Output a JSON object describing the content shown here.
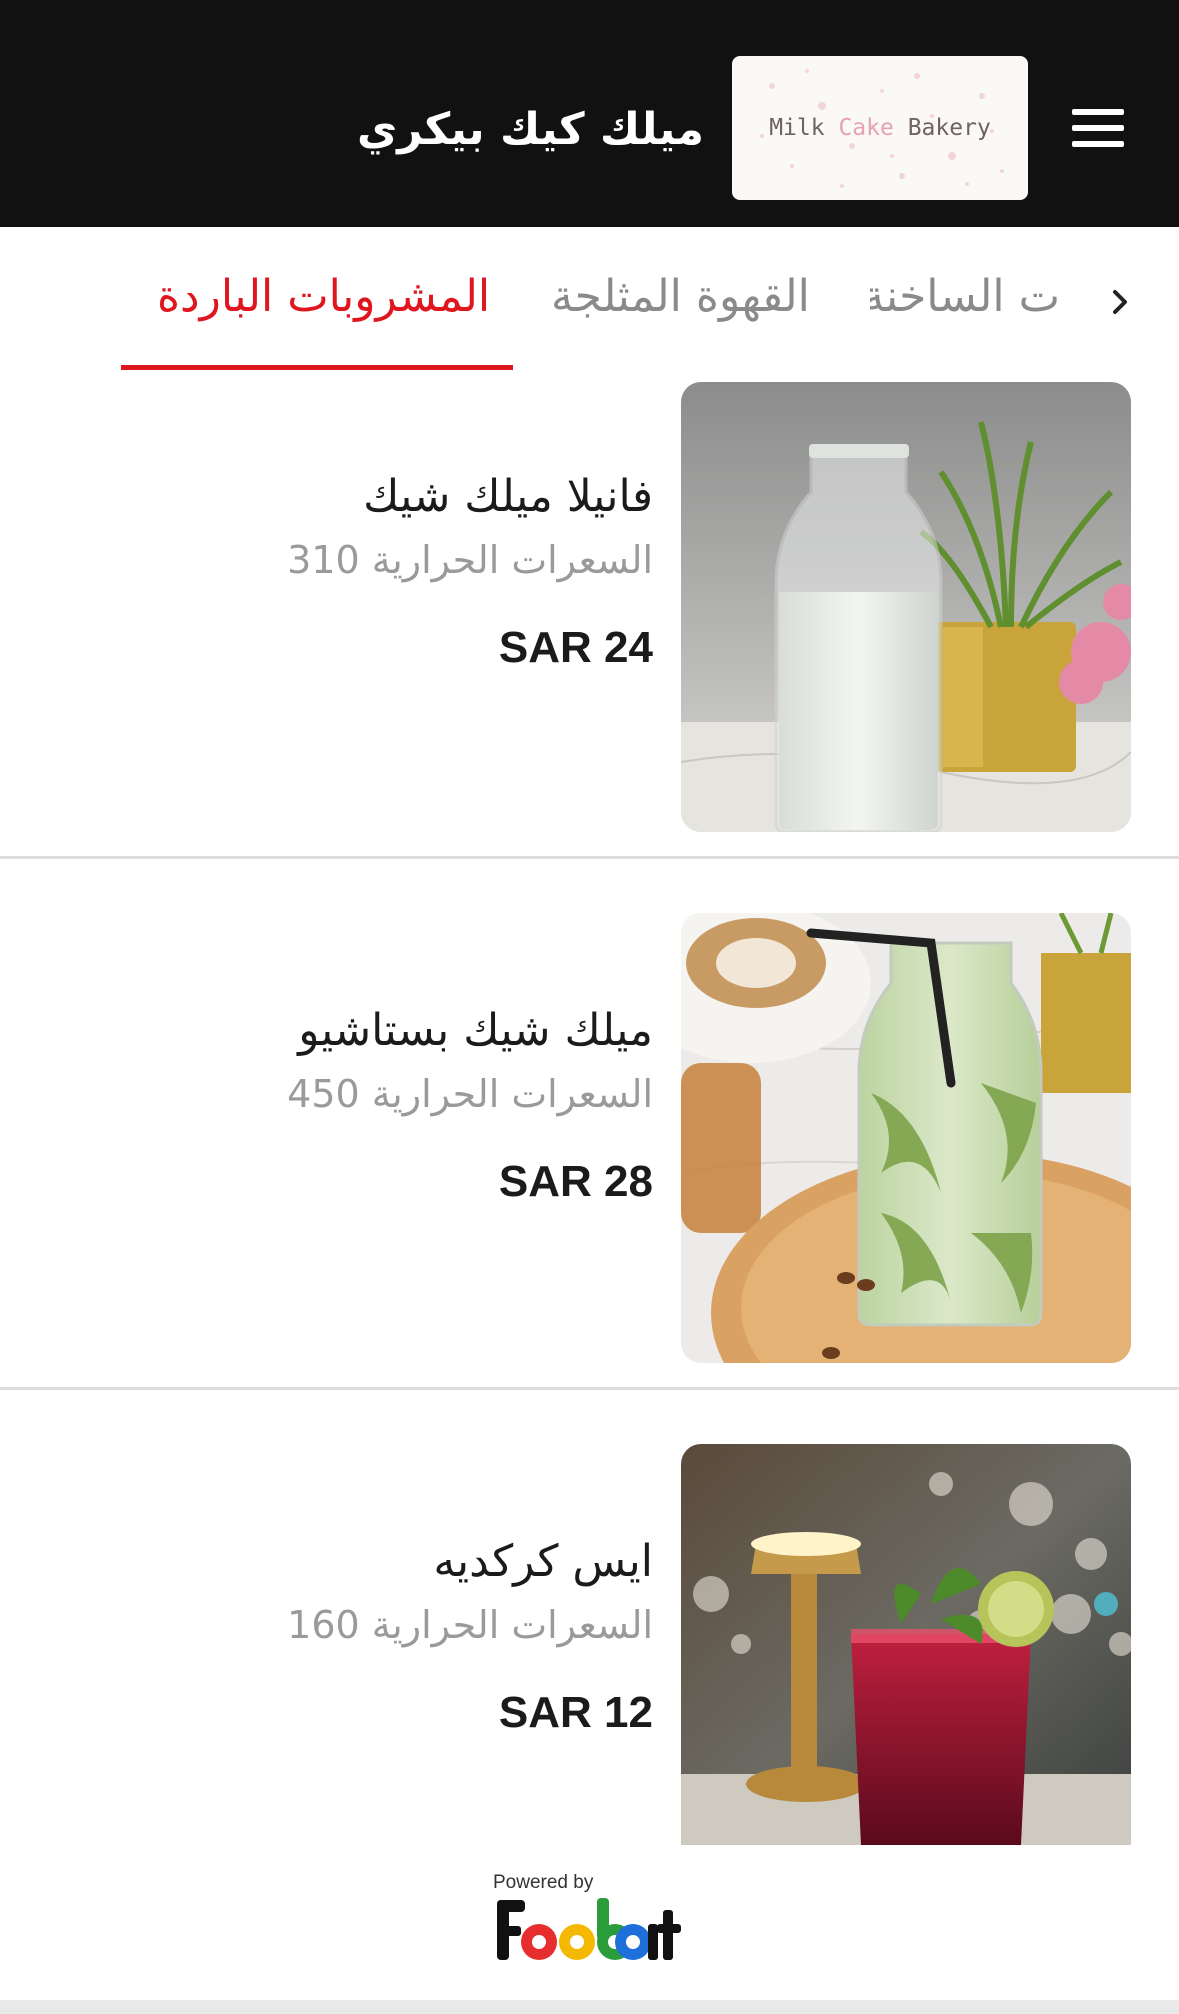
{
  "header": {
    "store_name": "ميلك كيك بيكري",
    "logo_text_1": "Milk",
    "logo_text_2": "Cake",
    "logo_text_3": "Bakery",
    "menu_icon": "hamburger-menu-icon"
  },
  "tabs": [
    {
      "label": "المشروبات الباردة",
      "active": true
    },
    {
      "label": "القهوة المثلجة",
      "active": false
    },
    {
      "label": "ت الساخنة",
      "active": false
    }
  ],
  "tab_scroll_icon": "chevron-right-icon",
  "items": [
    {
      "name": "فانيلا ميلك شيك",
      "calories": "السعرات الحرارية 310",
      "price": "SAR 24"
    },
    {
      "name": "ميلك شيك بستاشيو",
      "calories": "السعرات الحرارية 450",
      "price": "SAR 28"
    },
    {
      "name": "ايس كركديه",
      "calories": "السعرات الحرارية 160",
      "price": "SAR 12"
    }
  ],
  "footer": {
    "powered_by": "Powered by",
    "brand": "foodbit",
    "brand_colors": [
      "#111111",
      "#e62e2e",
      "#f5b800",
      "#2a9d3a",
      "#1e6fd9"
    ]
  },
  "colors": {
    "header_bg": "#111111",
    "accent": "#e0161f",
    "inactive_tab": "#8a8a8a"
  }
}
